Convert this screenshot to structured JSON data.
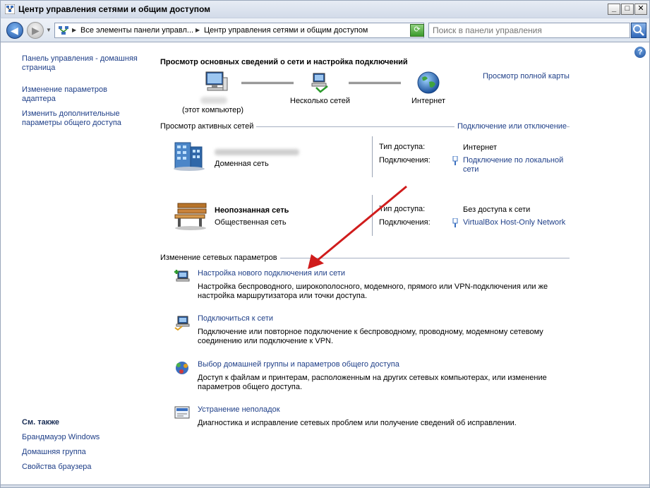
{
  "window": {
    "title": "Центр управления сетями и общим доступом"
  },
  "address": {
    "crumbs": [
      "Все элементы панели управл...",
      "Центр управления сетями и общим доступом"
    ],
    "search_placeholder": "Поиск в панели управления"
  },
  "sidebar": {
    "links": [
      "Панель управления - домашняя страница",
      "Изменение параметров адаптера",
      "Изменить дополнительные параметры общего доступа"
    ],
    "see_also_title": "См. также",
    "see_also": [
      "Брандмауэр Windows",
      "Домашняя группа",
      "Свойства браузера"
    ]
  },
  "overview": {
    "heading": "Просмотр основных сведений о сети и настройка подключений",
    "full_map": "Просмотр полной карты",
    "nodes": [
      "(этот компьютер)",
      "Несколько сетей",
      "Интернет"
    ]
  },
  "active": {
    "title": "Просмотр активных сетей",
    "connect_link": "Подключение или отключение",
    "access_label": "Тип доступа:",
    "connections_label": "Подключения:",
    "networks": [
      {
        "name": "",
        "category": "Доменная сеть",
        "access": "Интернет",
        "connection": "Подключение по локальной сети"
      },
      {
        "name": "Неопознанная сеть",
        "category": "Общественная сеть",
        "access": "Без доступа к сети",
        "connection": "VirtualBox Host-Only Network"
      }
    ]
  },
  "change": {
    "title": "Изменение сетевых параметров",
    "tasks": [
      {
        "link": "Настройка нового подключения или сети",
        "desc": "Настройка беспроводного, широкополосного, модемного, прямого или VPN-подключения или же настройка маршрутизатора или точки доступа."
      },
      {
        "link": "Подключиться к сети",
        "desc": "Подключение или повторное подключение к беспроводному, проводному, модемному сетевому соединению или подключение к VPN."
      },
      {
        "link": "Выбор домашней группы и параметров общего доступа",
        "desc": "Доступ к файлам и принтерам, расположенным на других сетевых компьютерах, или изменение параметров общего доступа."
      },
      {
        "link": "Устранение неполадок",
        "desc": "Диагностика и исправление сетевых проблем или получение сведений об исправлении."
      }
    ]
  },
  "colors": {
    "link": "#1f3f88",
    "arrow": "#d01c1c"
  },
  "icons": [
    "network-center-icon",
    "back-arrow-icon",
    "forward-arrow-icon",
    "refresh-icon",
    "search-icon",
    "help-icon",
    "computer-icon",
    "network-icon",
    "globe-icon",
    "domain-network-icon",
    "bench-icon",
    "ethernet-icon",
    "new-connection-icon",
    "connect-icon",
    "homegroup-icon",
    "troubleshoot-icon"
  ]
}
